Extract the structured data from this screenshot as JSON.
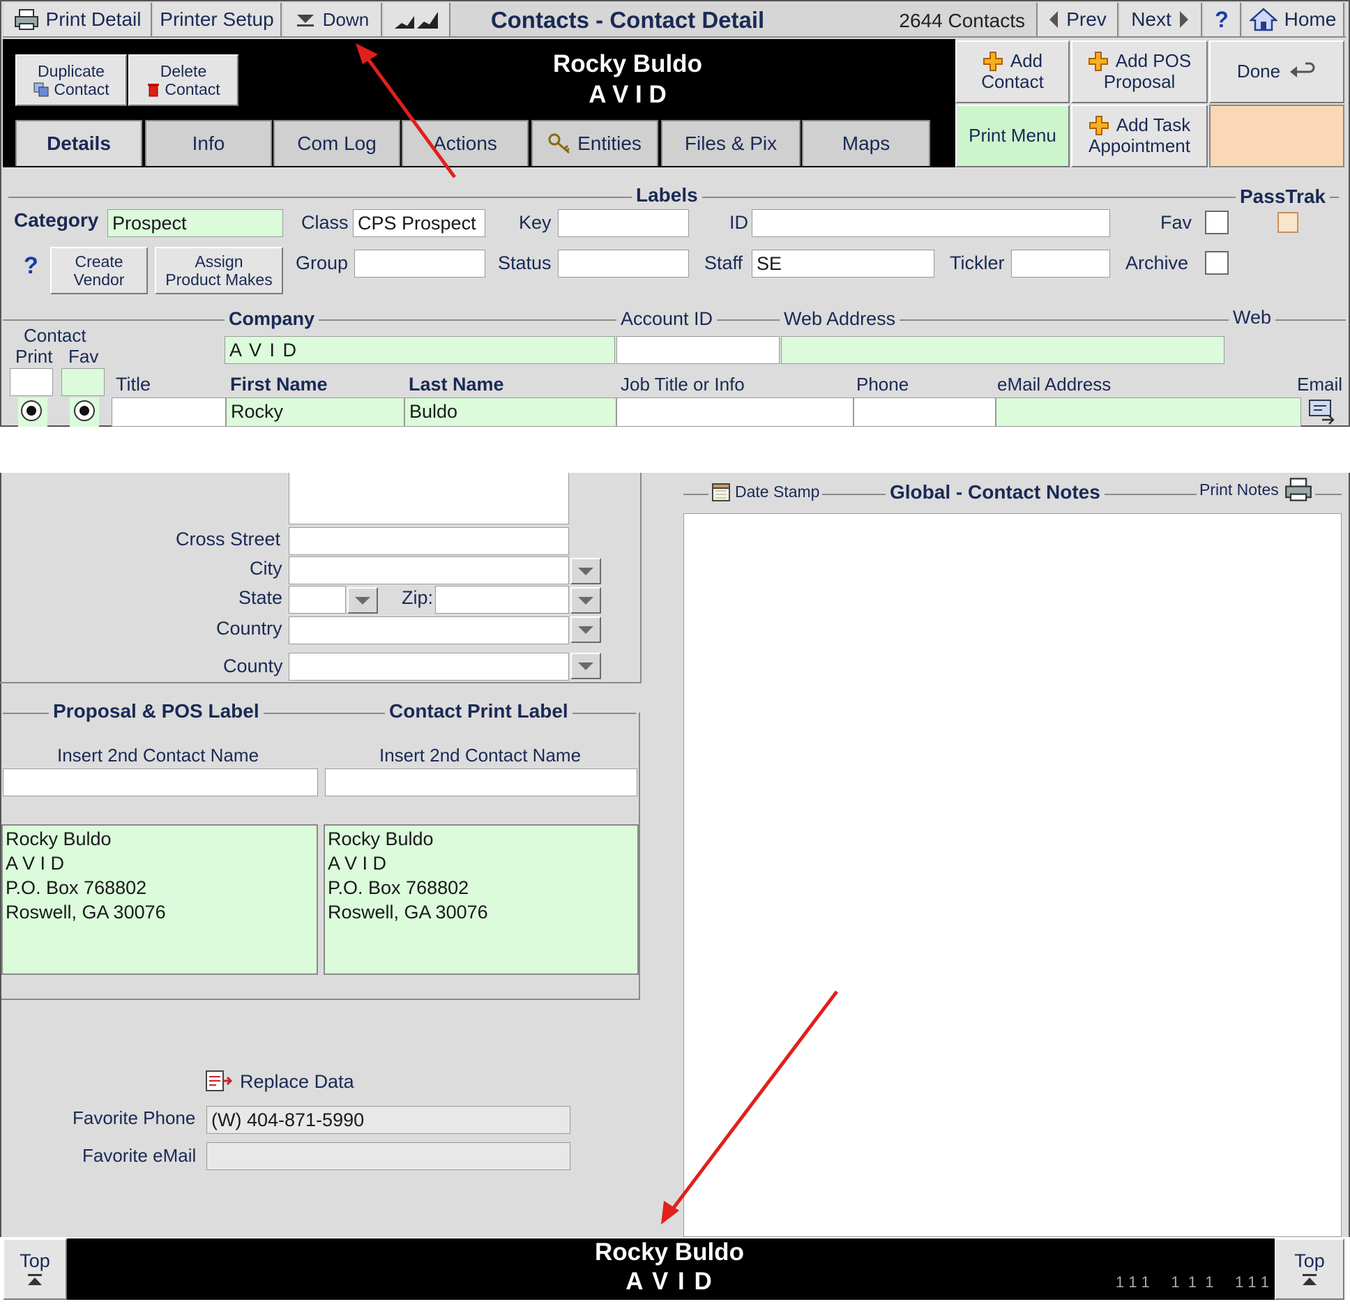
{
  "toolbar": {
    "print_detail": "Print Detail",
    "printer_setup": "Printer Setup",
    "down": "Down",
    "title": "Contacts - Contact Detail",
    "count": "2644 Contacts",
    "prev": "Prev",
    "next": "Next",
    "help": "?",
    "home": "Home"
  },
  "header": {
    "duplicate_line1": "Duplicate",
    "duplicate_line2": "Contact",
    "delete_line1": "Delete",
    "delete_line2": "Contact",
    "contact_name": "Rocky Buldo",
    "company": "A V I D",
    "add_contact_line1": "Add",
    "add_contact_line2": "Contact",
    "add_pos_line1": "Add POS",
    "add_pos_line2": "Proposal",
    "done": "Done",
    "print_menu": "Print Menu",
    "add_task_line1": "Add Task",
    "add_task_line2": "Appointment"
  },
  "tabs": [
    "Details",
    "Info",
    "Com Log",
    "Actions",
    "Entities",
    "Files & Pix",
    "Maps"
  ],
  "labels_section": {
    "heading": "Labels",
    "passtrak": "PassTrak",
    "category_label": "Category",
    "category_value": "Prospect",
    "class_label": "Class",
    "class_value": "CPS Prospect",
    "key_label": "Key",
    "key_value": "",
    "id_label": "ID",
    "id_value": "",
    "fav_label": "Fav",
    "help": "?",
    "create_vendor_line1": "Create",
    "create_vendor_line2": "Vendor",
    "assign_line1": "Assign",
    "assign_line2": "Product Makes",
    "group_label": "Group",
    "group_value": "",
    "status_label": "Status",
    "status_value": "",
    "staff_label": "Staff",
    "staff_value": "SE",
    "tickler_label": "Tickler",
    "tickler_value": "",
    "archive_label": "Archive"
  },
  "company_section": {
    "contact_label": "Contact",
    "print_label": "Print",
    "fav_label": "Fav",
    "company_label": "Company",
    "company_value": "A V I D",
    "account_id_label": "Account ID",
    "account_id_value": "",
    "web_address_label": "Web Address",
    "web_address_value": "",
    "web_label": "Web"
  },
  "people_table": {
    "columns": [
      "Title",
      "First Name",
      "Last Name",
      "Job Title or Info",
      "Phone",
      "eMail Address",
      "Email"
    ],
    "row": {
      "title": "",
      "first_name": "Rocky",
      "last_name": "Buldo",
      "job_title": "",
      "phone": "",
      "email": ""
    }
  },
  "address": {
    "cross_street_label": "Cross Street",
    "cross_street_value": "",
    "city_label": "City",
    "city_value": "",
    "state_label": "State",
    "state_value": "",
    "zip_label": "Zip:",
    "zip_value": "",
    "country_label": "Country",
    "country_value": "",
    "county_label": "County",
    "county_value": ""
  },
  "notes": {
    "date_stamp": "Date Stamp",
    "title": "Global - Contact Notes",
    "print_notes": "Print Notes",
    "body": ""
  },
  "labels_print": {
    "proposal_heading": "Proposal & POS Label",
    "contact_heading": "Contact Print Label",
    "insert_2nd_left": "Insert 2nd Contact Name",
    "insert_2nd_right": "Insert 2nd Contact Name",
    "proposal_label_text": "Rocky Buldo\nA V I D\nP.O. Box 768802\nRoswell, GA 30076",
    "contact_label_text": "Rocky Buldo\nA V I D\nP.O. Box 768802\nRoswell, GA 30076"
  },
  "favorites": {
    "replace_data": "Replace Data",
    "phone_label": "Favorite Phone",
    "phone_value": "(W) 404-871-5990",
    "email_label": "Favorite eMail",
    "email_value": ""
  },
  "footer": {
    "top_left": "Top",
    "top_right": "Top",
    "contact_name": "Rocky Buldo",
    "company": "A V I D",
    "counters": "1 1 1     1  1  1     1 1 1"
  },
  "colors": {
    "panel_gray": "#dcdcdc",
    "header_black": "#000000",
    "field_green": "#dbfbdb",
    "label_blue": "#1a2a55",
    "print_menu_green": "#ccf5cc",
    "peach": "#fbd7b5",
    "annotation_arrow": "#e0201c"
  }
}
